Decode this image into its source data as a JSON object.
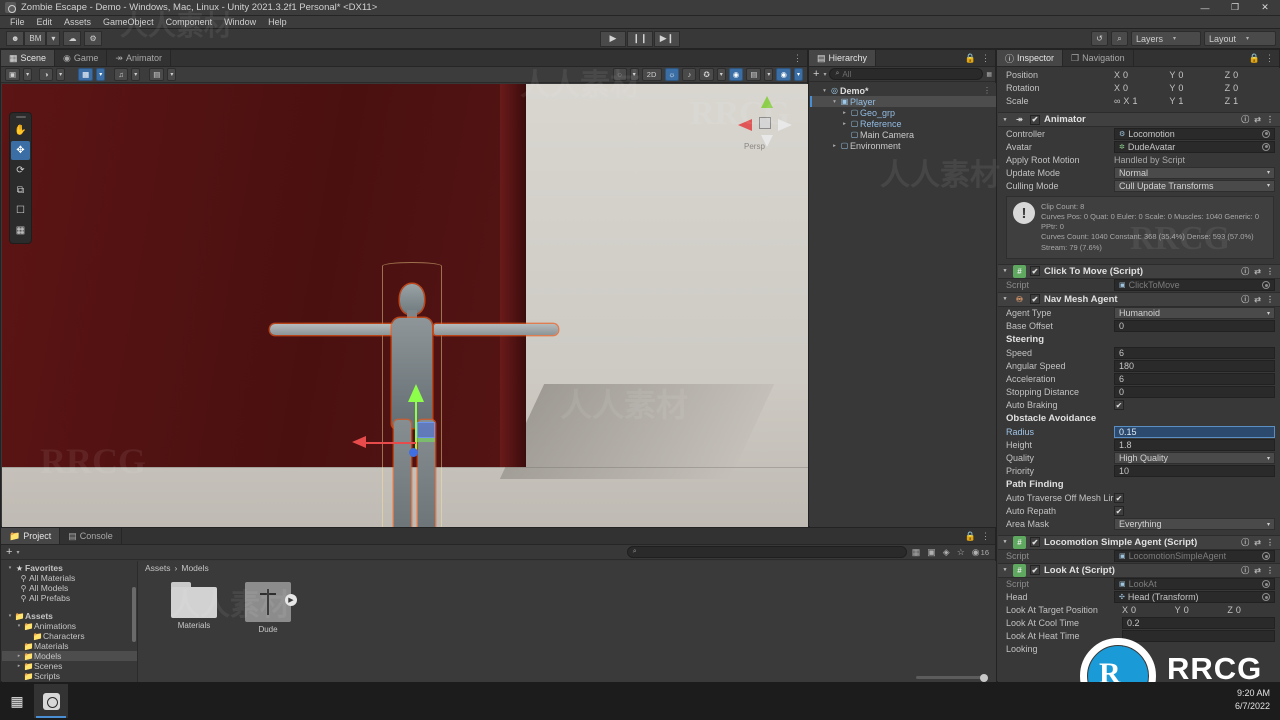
{
  "window": {
    "title": "Zombie Escape - Demo - Windows, Mac, Linux - Unity 2021.3.2f1 Personal* <DX11>",
    "minimize": "—",
    "maximize": "❐",
    "close": "✕"
  },
  "menu": {
    "items": [
      "File",
      "Edit",
      "Assets",
      "GameObject",
      "Component",
      "Window",
      "Help"
    ]
  },
  "toolbar": {
    "account_label": "BM",
    "account_caret": "▾",
    "cloud_icon": "cloud-icon",
    "settings_icon": "gear-icon",
    "play": "▶",
    "pause": "❙❙",
    "step": "▶❙",
    "undo_history_icon": "history-icon",
    "search_icon": "⌕",
    "layers_label": "Layers",
    "layout_label": "Layout",
    "caret": "▾"
  },
  "scene": {
    "tabs": [
      {
        "label": "Scene",
        "icon": "scene-icon",
        "active": true
      },
      {
        "label": "Game",
        "icon": "game-icon",
        "active": false
      },
      {
        "label": "Animator",
        "icon": "animator-icon",
        "active": false
      }
    ],
    "left_tools": [
      {
        "name": "shading-mode",
        "glyph": "▣"
      },
      {
        "name": "shading-mode-caret",
        "glyph": "▾"
      },
      {
        "name": "draw-mode",
        "glyph": "◑"
      },
      {
        "name": "draw-mode-caret",
        "glyph": "▾"
      },
      {
        "name": "2d-toggle",
        "glyph": "2D"
      },
      {
        "name": "lighting-toggle",
        "glyph": "☀"
      },
      {
        "name": "audio-toggle",
        "glyph": "♫"
      },
      {
        "name": "effects-toggle",
        "glyph": "❖"
      },
      {
        "name": "effects-caret",
        "glyph": "▾"
      }
    ],
    "right_tools": [
      {
        "name": "scene-visibility",
        "glyph": "◔"
      },
      {
        "name": "scene-visibility-caret",
        "glyph": "▾"
      },
      {
        "name": "2d-button",
        "glyph": "2D"
      },
      {
        "name": "lighting-button",
        "glyph": "☀",
        "on": true
      },
      {
        "name": "audio-button",
        "glyph": "♪"
      },
      {
        "name": "fx-button",
        "glyph": "✦"
      },
      {
        "name": "fx-caret",
        "glyph": "▾"
      },
      {
        "name": "hidden-objects-button",
        "glyph": "◉",
        "on": true
      },
      {
        "name": "camera-button",
        "glyph": "▤"
      },
      {
        "name": "camera-caret",
        "glyph": "▾"
      },
      {
        "name": "gizmos-button",
        "glyph": "⚙",
        "on": true
      },
      {
        "name": "gizmos-caret",
        "glyph": "▾"
      }
    ],
    "overlay_tools": [
      {
        "name": "hand-tool",
        "glyph": "✋",
        "active": false
      },
      {
        "name": "move-tool",
        "glyph": "✥",
        "active": true
      },
      {
        "name": "rotate-tool",
        "glyph": "⟳",
        "active": false
      },
      {
        "name": "scale-tool",
        "glyph": "⧉",
        "active": false
      },
      {
        "name": "rect-tool",
        "glyph": "▢",
        "active": false
      },
      {
        "name": "transform-tool",
        "glyph": "⬚",
        "active": false
      }
    ],
    "gizmo_persp_label": "Persp"
  },
  "hierarchy": {
    "tab_label": "Hierarchy",
    "add_button": "+",
    "add_caret": "▾",
    "search_placeholder": "All",
    "search_icon": "⌕",
    "items": [
      {
        "label": "Demo*",
        "depth": 0,
        "tri": "▾",
        "icon": "scene-icon",
        "selected": false,
        "prefab": false,
        "menu": "⋮"
      },
      {
        "label": "Player",
        "depth": 1,
        "tri": "▾",
        "icon": "prefab-icon",
        "selected": true,
        "prefab": true
      },
      {
        "label": "Geo_grp",
        "depth": 2,
        "tri": "▸",
        "icon": "gameobject-icon",
        "selected": false,
        "prefab": true
      },
      {
        "label": "Reference",
        "depth": 2,
        "tri": "▸",
        "icon": "gameobject-icon",
        "selected": false,
        "prefab": true
      },
      {
        "label": "Main Camera",
        "depth": 2,
        "tri": "",
        "icon": "gameobject-icon",
        "selected": false,
        "prefab": false
      },
      {
        "label": "Environment",
        "depth": 1,
        "tri": "▸",
        "icon": "gameobject-icon",
        "selected": false,
        "prefab": false
      }
    ]
  },
  "inspector": {
    "tabs": [
      {
        "label": "Inspector",
        "icon": "info-icon",
        "active": true
      },
      {
        "label": "Navigation",
        "icon": "navigation-icon",
        "active": false
      }
    ],
    "lock_icon": "lock-icon",
    "menu_icon": "⋮",
    "transform": {
      "position": {
        "label": "Position",
        "x": "0",
        "y": "0",
        "z": "0"
      },
      "rotation": {
        "label": "Rotation",
        "x": "0",
        "y": "0",
        "z": "0"
      },
      "scale": {
        "label": "Scale",
        "x": "1",
        "y": "1",
        "z": "1",
        "link_icon": "link-icon"
      }
    },
    "animator": {
      "title": "Animator",
      "help": "?",
      "preset": "⇄",
      "menu": "⋮",
      "controller_label": "Controller",
      "controller_value": "Locomotion",
      "avatar_label": "Avatar",
      "avatar_value": "DudeAvatar",
      "apply_root_motion_label": "Apply Root Motion",
      "apply_root_motion_value": "Handled by Script",
      "update_mode_label": "Update Mode",
      "update_mode_value": "Normal",
      "culling_mode_label": "Culling Mode",
      "culling_mode_value": "Cull Update Transforms",
      "info_line1": "Clip Count: 8",
      "info_line2": "Curves Pos: 0 Quat: 0 Euler: 0 Scale: 0 Muscles: 1040 Generic: 0 PPtr: 0",
      "info_line3": "Curves Count: 1040 Constant: 368 (35.4%) Dense: 593 (57.0%) Stream: 79 (7.6%)"
    },
    "click_to_move": {
      "title": "Click To Move (Script)",
      "script_label": "Script",
      "script_value": "ClickToMove"
    },
    "nav_mesh_agent": {
      "title": "Nav Mesh Agent",
      "agent_type_label": "Agent Type",
      "agent_type_value": "Humanoid",
      "base_offset_label": "Base Offset",
      "base_offset_value": "0",
      "steering_label": "Steering",
      "speed_label": "Speed",
      "speed_value": "6",
      "angular_speed_label": "Angular Speed",
      "angular_speed_value": "180",
      "acceleration_label": "Acceleration",
      "acceleration_value": "6",
      "stopping_distance_label": "Stopping Distance",
      "stopping_distance_value": "0",
      "auto_braking_label": "Auto Braking",
      "auto_braking_value": "✔",
      "obstacle_avoidance_label": "Obstacle Avoidance",
      "radius_label": "Radius",
      "radius_value": "0.15",
      "height_label": "Height",
      "height_value": "1.8",
      "quality_label": "Quality",
      "quality_value": "High Quality",
      "priority_label": "Priority",
      "priority_value": "10",
      "path_finding_label": "Path Finding",
      "auto_traverse_label": "Auto Traverse Off Mesh Lir",
      "auto_traverse_value": "✔",
      "auto_repath_label": "Auto Repath",
      "auto_repath_value": "✔",
      "area_mask_label": "Area Mask",
      "area_mask_value": "Everything"
    },
    "locomotion_simple_agent": {
      "title": "Locomotion Simple Agent (Script)",
      "script_label": "Script",
      "script_value": "LocomotionSimpleAgent"
    },
    "look_at": {
      "title": "Look At (Script)",
      "script_label": "Script",
      "script_value": "LookAt",
      "head_label": "Head",
      "head_value": "Head (Transform)",
      "target_position_label": "Look At Target Position",
      "target_x": "0",
      "target_y": "0",
      "target_z": "0",
      "cool_time_label": "Look At Cool Time",
      "cool_time_value": "0.2",
      "heat_time_label": "Look At Heat Time",
      "heat_time_value": "",
      "looking_label": "Looking",
      "looking_value": ""
    }
  },
  "project": {
    "tabs": [
      {
        "label": "Project",
        "icon": "folder-icon",
        "active": true
      },
      {
        "label": "Console",
        "icon": "console-icon",
        "active": false
      }
    ],
    "add_button": "+",
    "add_caret": "▾",
    "search_placeholder": "",
    "search_icon": "⌕",
    "filter_icons": [
      "save-filter-icon",
      "type-filter-icon",
      "label-filter-icon",
      "favorite-icon"
    ],
    "size_value": "16",
    "tree": [
      {
        "label": "Favorites",
        "depth": 0,
        "tri": "▾",
        "icon": "★",
        "selected": false
      },
      {
        "label": "All Materials",
        "depth": 1,
        "tri": "",
        "icon": "⌕",
        "selected": false
      },
      {
        "label": "All Models",
        "depth": 1,
        "tri": "",
        "icon": "⌕",
        "selected": false
      },
      {
        "label": "All Prefabs",
        "depth": 1,
        "tri": "",
        "icon": "⌕",
        "selected": false
      },
      {
        "label": "",
        "depth": 0,
        "tri": "",
        "icon": "",
        "selected": false
      },
      {
        "label": "Assets",
        "depth": 0,
        "tri": "▾",
        "icon": "▰",
        "selected": false
      },
      {
        "label": "Animations",
        "depth": 1,
        "tri": "▾",
        "icon": "▰",
        "selected": false
      },
      {
        "label": "Characters",
        "depth": 2,
        "tri": "",
        "icon": "▰",
        "selected": false
      },
      {
        "label": "Materials",
        "depth": 1,
        "tri": "",
        "icon": "▰",
        "selected": false
      },
      {
        "label": "Models",
        "depth": 1,
        "tri": "▸",
        "icon": "▰",
        "selected": true
      },
      {
        "label": "Scenes",
        "depth": 1,
        "tri": "▸",
        "icon": "▰",
        "selected": false
      },
      {
        "label": "Scripts",
        "depth": 1,
        "tri": "",
        "icon": "▰",
        "selected": false
      }
    ],
    "breadcrumb": [
      "Assets",
      "Models"
    ],
    "breadcrumb_sep": "›",
    "assets": [
      {
        "name": "Materials",
        "kind": "folder"
      },
      {
        "name": "Dude",
        "kind": "model",
        "play_glyph": "▶"
      }
    ]
  },
  "taskbar": {
    "start_icon": "windows-icon",
    "app_icon": "unity-icon",
    "time": "9:20 AM",
    "date": "6/7/2022"
  },
  "watermarks": {
    "cn_text": "人人素材",
    "rrcg": "RRCG"
  }
}
